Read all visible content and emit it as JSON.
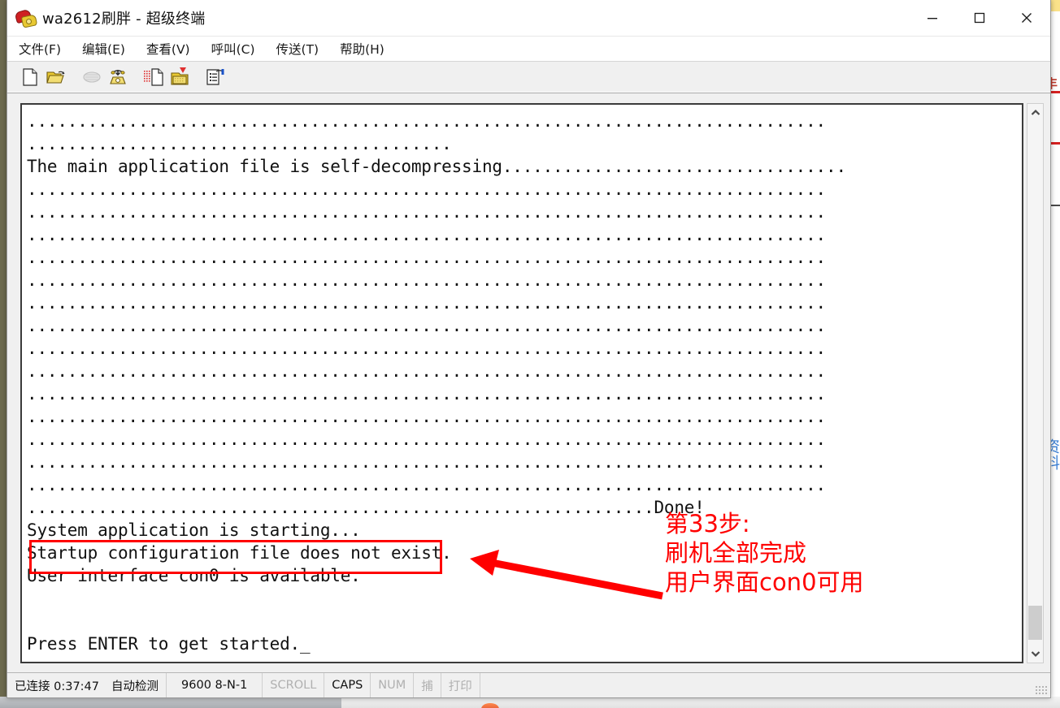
{
  "window": {
    "title": "wa2612刷胖 - 超级终端",
    "app_icon": "phone-icon",
    "controls": {
      "minimize": "minimize-icon",
      "maximize": "maximize-icon",
      "close": "close-icon"
    }
  },
  "menubar": {
    "items": [
      {
        "label": "文件(F)"
      },
      {
        "label": "编辑(E)"
      },
      {
        "label": "查看(V)"
      },
      {
        "label": "呼叫(C)"
      },
      {
        "label": "传送(T)"
      },
      {
        "label": "帮助(H)"
      }
    ]
  },
  "toolbar": {
    "buttons": [
      {
        "name": "new-connection-icon",
        "title": "新建连接"
      },
      {
        "name": "open-connection-icon",
        "title": "打开"
      },
      {
        "name": "disconnect-phone-icon",
        "title": "挂断",
        "disabled": true
      },
      {
        "name": "connect-phone-icon",
        "title": "呼叫"
      },
      {
        "name": "send-file-icon",
        "title": "发送文件"
      },
      {
        "name": "receive-file-icon",
        "title": "接收文件"
      },
      {
        "name": "properties-icon",
        "title": "属性"
      }
    ]
  },
  "terminal": {
    "lines": [
      "...............................................................................",
      "..........................................",
      "The main application file is self-decompressing..................................",
      "...............................................................................",
      "...............................................................................",
      "...............................................................................",
      "...............................................................................",
      "...............................................................................",
      "...............................................................................",
      "...............................................................................",
      "...............................................................................",
      "...............................................................................",
      "...............................................................................",
      "...............................................................................",
      "...............................................................................",
      "...............................................................................",
      "...............................................................................",
      "..............................................................Done!",
      "System application is starting...",
      "Startup configuration file does not exist.",
      "User interface con0 is available.",
      "",
      "",
      "Press ENTER to get started._"
    ],
    "cursor": "_",
    "scrollbar": {
      "up_arrow": "chevron-up-icon",
      "down_arrow": "chevron-down-icon",
      "thumb_position": "bottom"
    }
  },
  "annotation": {
    "box_target_line": "User interface con0 is available.",
    "arrow": "arrow-left-icon",
    "color": "#ff0000",
    "text_lines": [
      "第33步:",
      "刷机全部完成",
      "用户界面con0可用"
    ]
  },
  "statusbar": {
    "connection": "已连接 0:37:47",
    "detection": "自动检测",
    "serial": "9600 8-N-1",
    "scroll": "SCROLL",
    "caps": "CAPS",
    "num": "NUM",
    "capture": "捕",
    "print": "打印"
  },
  "background": {
    "blue_text": "资料",
    "red_glyph": "丰"
  }
}
